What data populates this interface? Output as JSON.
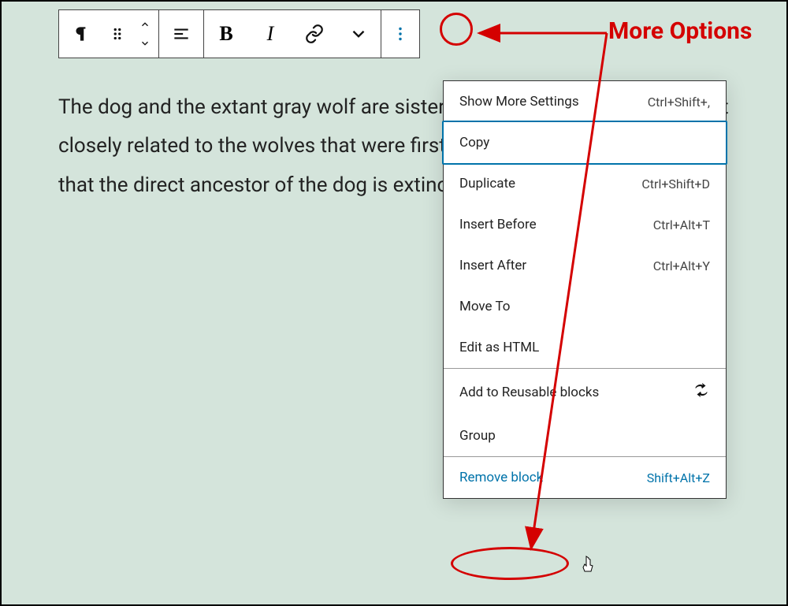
{
  "annotation": {
    "more_options_label": "More Options"
  },
  "content": {
    "paragraph": "The dog and the extant gray wolf are sister taxa as modern wolves are not closely related to the wolves that were first domesticated, which implies that the direct ancestor of the dog is extinct."
  },
  "menu": {
    "show_more_settings": {
      "label": "Show More Settings",
      "shortcut": "Ctrl+Shift+,"
    },
    "copy": {
      "label": "Copy",
      "shortcut": ""
    },
    "duplicate": {
      "label": "Duplicate",
      "shortcut": "Ctrl+Shift+D"
    },
    "insert_before": {
      "label": "Insert Before",
      "shortcut": "Ctrl+Alt+T"
    },
    "insert_after": {
      "label": "Insert After",
      "shortcut": "Ctrl+Alt+Y"
    },
    "move_to": {
      "label": "Move To",
      "shortcut": ""
    },
    "edit_html": {
      "label": "Edit as HTML",
      "shortcut": ""
    },
    "add_reusable": {
      "label": "Add to Reusable blocks",
      "shortcut": ""
    },
    "group": {
      "label": "Group",
      "shortcut": ""
    },
    "remove_block": {
      "label": "Remove block",
      "shortcut": "Shift+Alt+Z"
    }
  }
}
